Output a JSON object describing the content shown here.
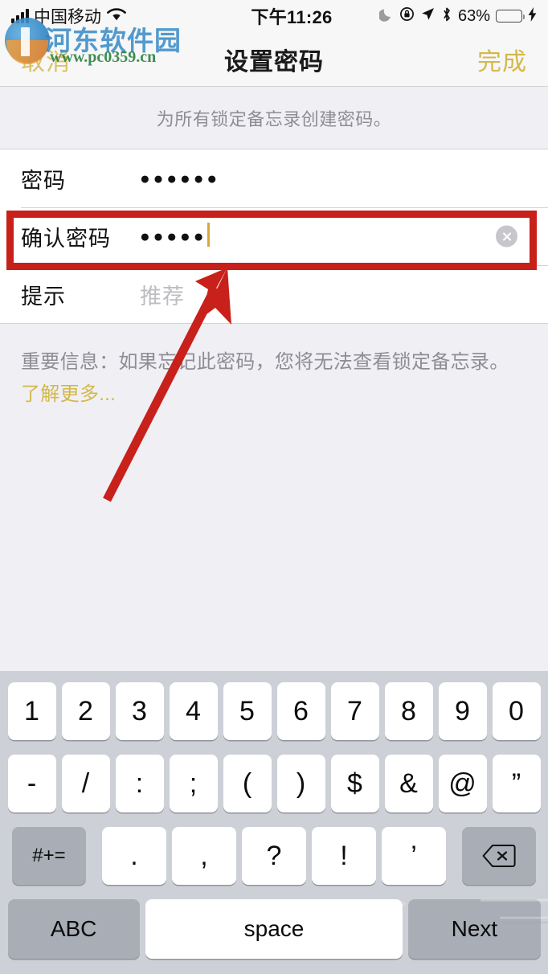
{
  "status_bar": {
    "carrier": "中国移动",
    "time": "下午11:26",
    "battery_percent": "63%",
    "icons": [
      "signal-bars-icon",
      "wifi-icon",
      "moon-icon",
      "rotation-lock-icon",
      "location-arrow-icon",
      "bluetooth-icon",
      "battery-icon",
      "charging-bolt-icon"
    ]
  },
  "nav_bar": {
    "cancel_label": "取消",
    "title": "设置密码",
    "done_label": "完成",
    "accent_color": "#d3b84b"
  },
  "watermark": {
    "site_name": "河东软件园",
    "url": "www.pc0359.cn"
  },
  "content": {
    "section_description": "为所有锁定备忘录创建密码。",
    "rows": [
      {
        "label": "密码",
        "value_dots": "●●●●●●",
        "dot_count": 6,
        "has_caret": false,
        "has_clear": false,
        "placeholder": ""
      },
      {
        "label": "确认密码",
        "value_dots": "●●●●●",
        "dot_count": 5,
        "has_caret": true,
        "has_clear": true,
        "placeholder": ""
      },
      {
        "label": "提示",
        "value_dots": "",
        "dot_count": 0,
        "has_caret": false,
        "has_clear": false,
        "placeholder": "推荐"
      }
    ],
    "footer_text": "重要信息：如果忘记此密码，您将无法查看锁定备忘录。 ",
    "footer_link": "了解更多..."
  },
  "annotation": {
    "highlight_color": "#c8201a",
    "box_target": "确认密码",
    "arrow_note": "red-arrow-pointing-to-confirm-password-field"
  },
  "keyboard": {
    "row1": [
      "1",
      "2",
      "3",
      "4",
      "5",
      "6",
      "7",
      "8",
      "9",
      "0"
    ],
    "row2": [
      "-",
      "/",
      ":",
      ";",
      "(",
      ")",
      "$",
      "&",
      "@",
      "”"
    ],
    "row3_shift": "#+=",
    "row3": [
      ".",
      ",",
      "?",
      "!",
      "’"
    ],
    "row3_backspace": "backspace-icon",
    "row4_abc": "ABC",
    "row4_space": "space",
    "row4_next": "Next"
  }
}
